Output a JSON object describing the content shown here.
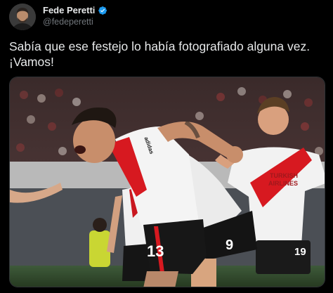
{
  "tweet": {
    "author": {
      "display_name": "Fede Peretti",
      "handle": "@fedeperetti",
      "verified": true,
      "avatar_icon": "profile-photo"
    },
    "text": {
      "line1": "Sabía que ese festejo lo había fotografiado alguna vez.",
      "line2": "¡Vamos!"
    },
    "media": {
      "type": "photo",
      "jersey_sponsor_line1": "TURKISH",
      "jersey_sponsor_line2": "AIRLINES",
      "number_front": "13",
      "number_middle": "9",
      "number_right": "19",
      "sleeve_text": "adidas"
    }
  },
  "colors": {
    "background": "#000000",
    "text_primary": "#e7e9ea",
    "text_secondary": "#71767b",
    "verified_blue": "#1d9bf0",
    "jersey_red": "#d71920",
    "jersey_white": "#f2f2f2"
  }
}
